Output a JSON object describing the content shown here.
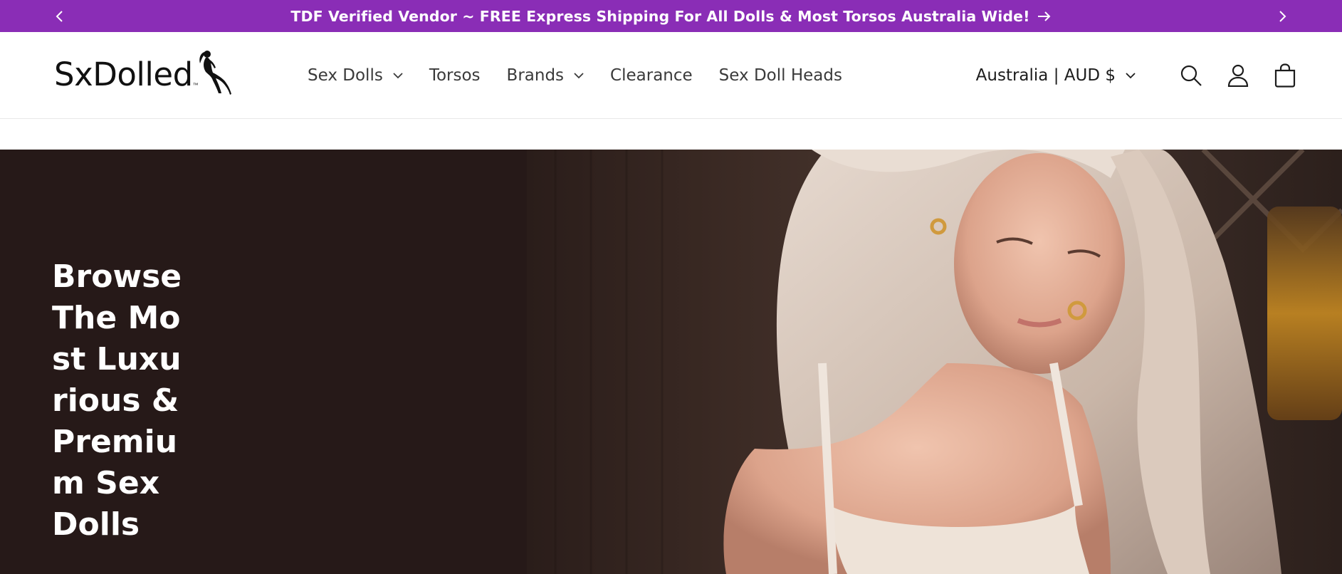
{
  "announcement": {
    "text": "TDF Verified Vendor ~ FREE Express Shipping For All Dolls & Most Torsos Australia Wide!",
    "background": "#8a2db6",
    "prev_icon": "chevron-left-icon",
    "next_icon": "chevron-right-icon",
    "link_icon": "arrow-right-icon"
  },
  "header": {
    "logo_text": "SxDolled",
    "logo_tm": "™",
    "nav": [
      {
        "label": "Sex Dolls",
        "dropdown": true
      },
      {
        "label": "Torsos",
        "dropdown": false
      },
      {
        "label": "Brands",
        "dropdown": true
      },
      {
        "label": "Clearance",
        "dropdown": false
      },
      {
        "label": "Sex Doll Heads",
        "dropdown": false
      }
    ],
    "locale": "Australia | AUD $",
    "icons": [
      "search-icon",
      "account-icon",
      "cart-icon"
    ]
  },
  "hero": {
    "heading": "Browse The Most Luxurious & Premium Sex Dolls",
    "background": "#261918"
  }
}
